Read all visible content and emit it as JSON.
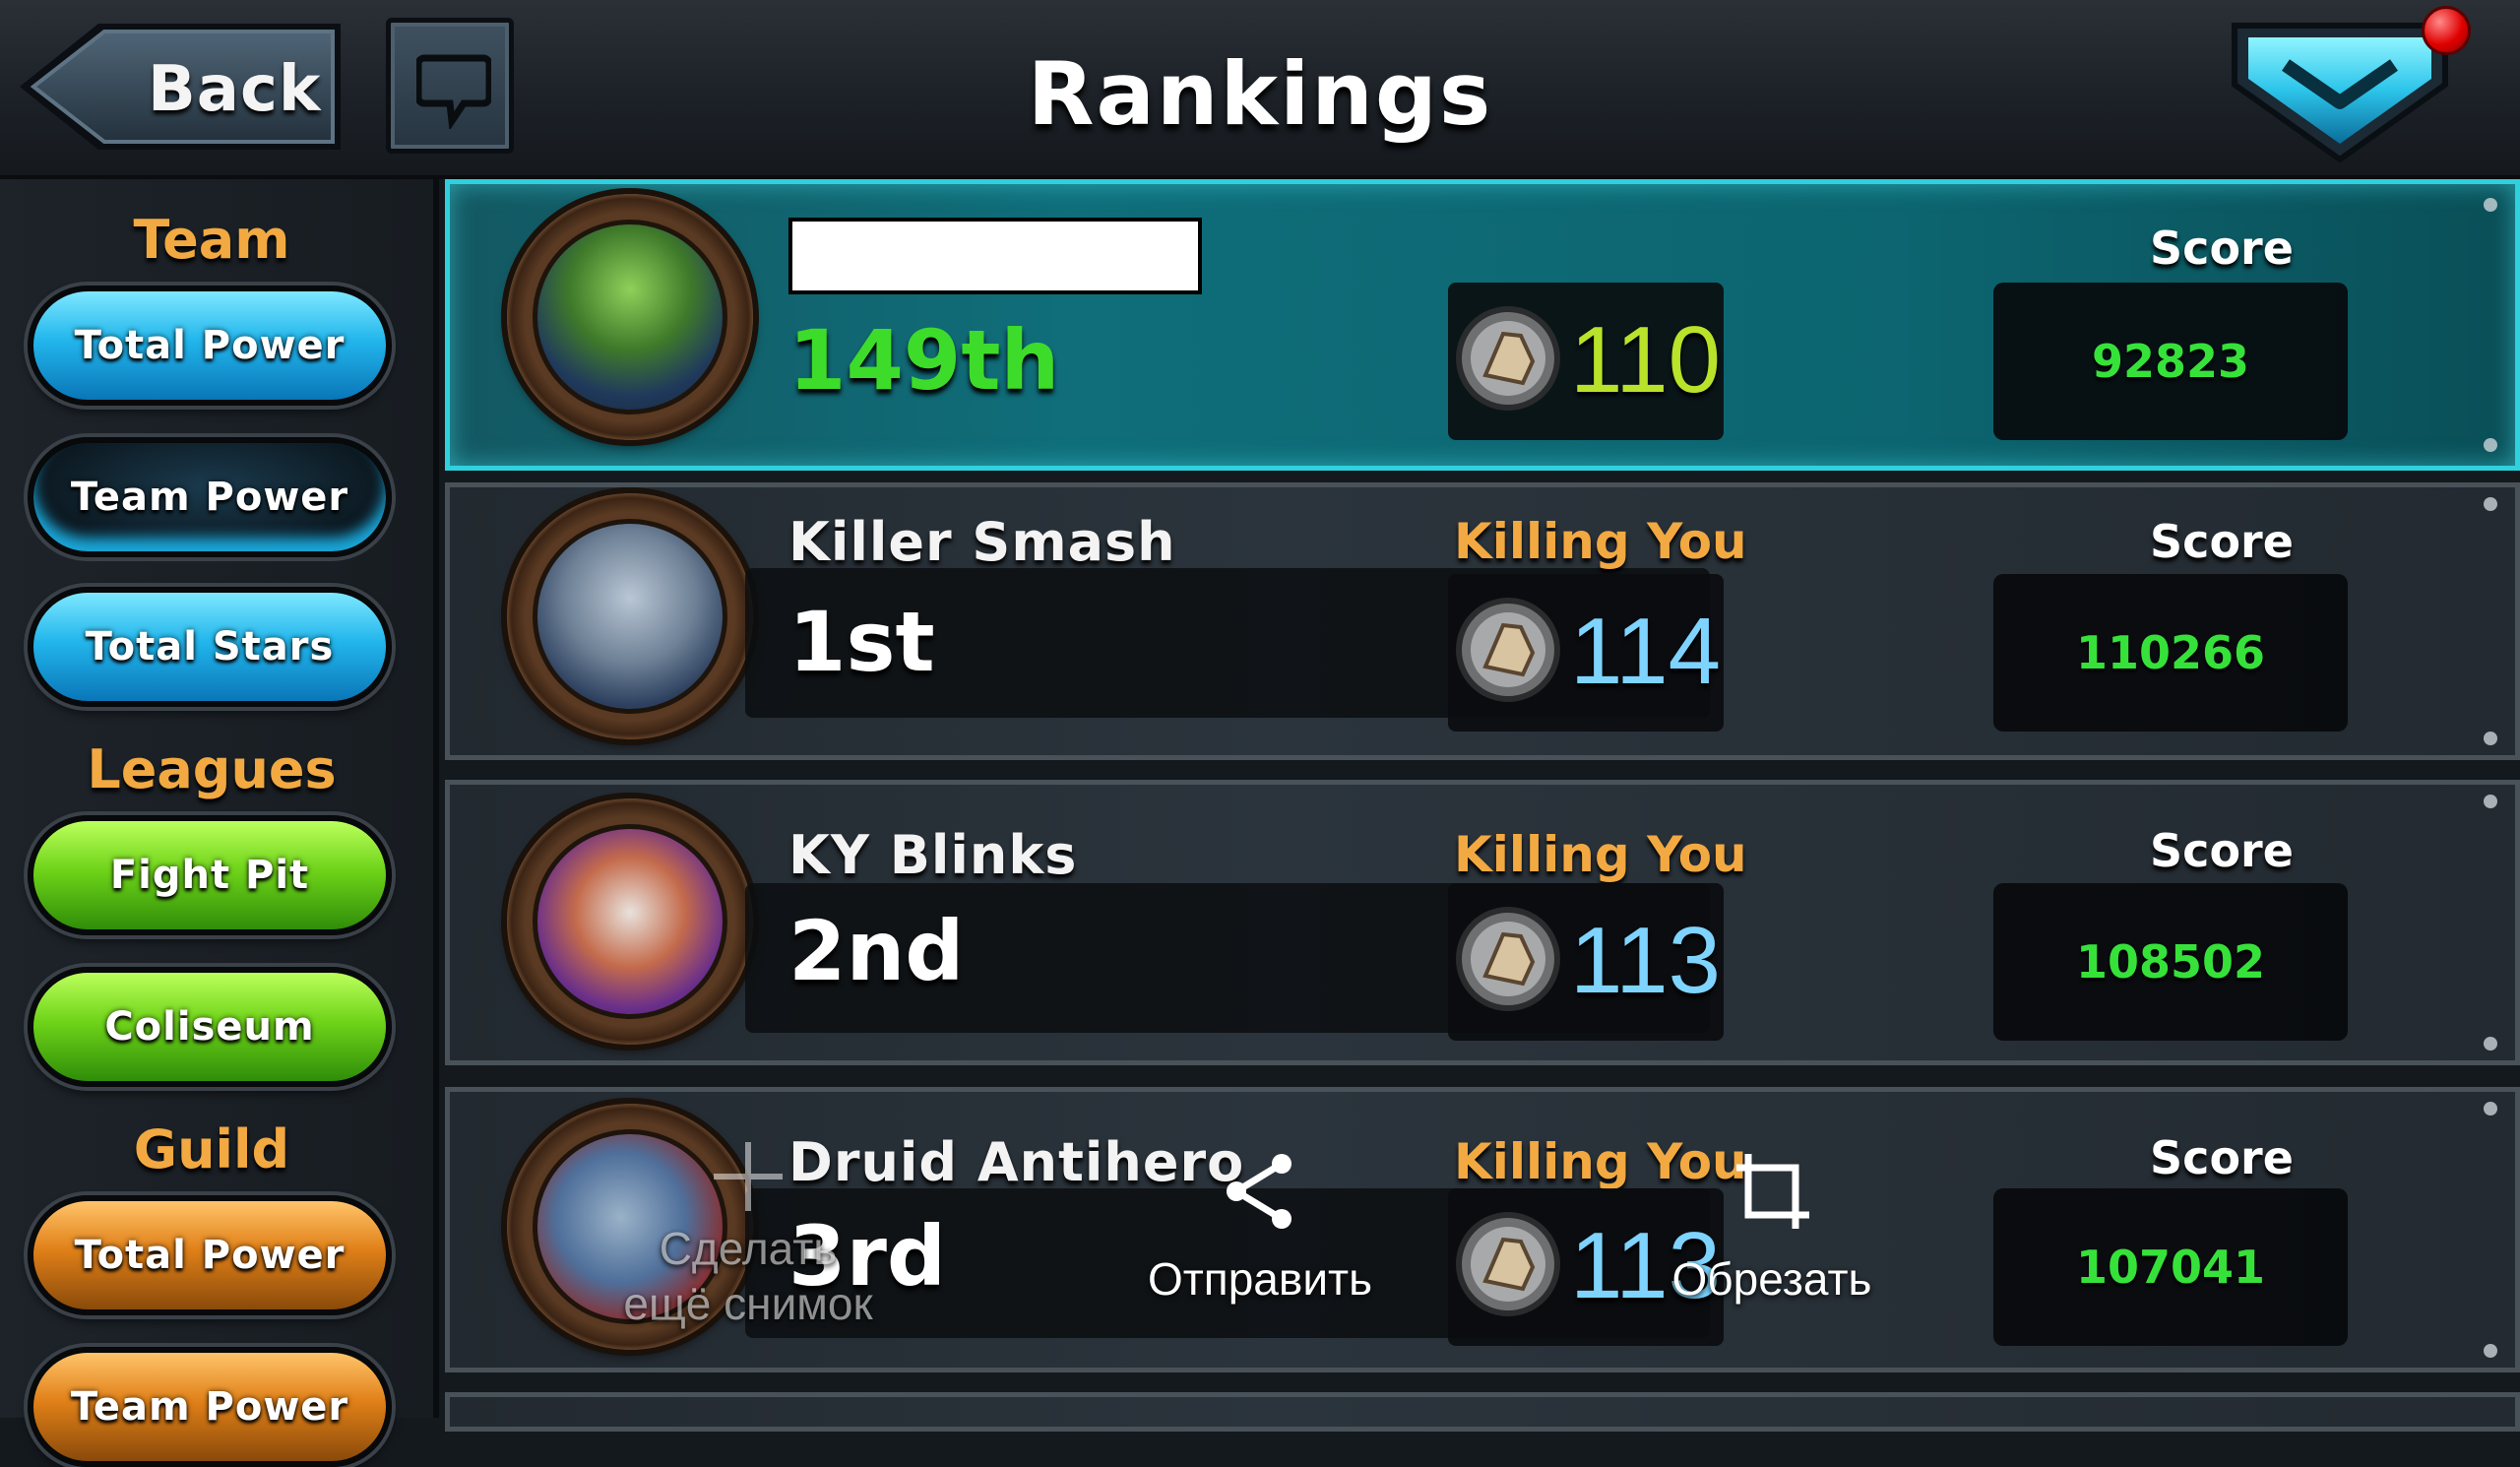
{
  "header": {
    "back_label": "Back",
    "title": "Rankings"
  },
  "sidebar": {
    "team_heading": "Team",
    "team_buttons": [
      "Total Power",
      "Team Power",
      "Total Stars"
    ],
    "leagues_heading": "Leagues",
    "league_buttons": [
      "Fight Pit",
      "Coliseum"
    ],
    "guild_heading": "Guild",
    "guild_buttons": [
      "Total Power",
      "Team Power"
    ]
  },
  "rows": [
    {
      "rank": "149th",
      "name": "",
      "guild": "",
      "power": "110",
      "score_label": "Score",
      "score": "92823",
      "is_me": true
    },
    {
      "rank": "1st",
      "name": "Killer Smash",
      "guild": "Killing You",
      "power": "114",
      "score_label": "Score",
      "score": "110266"
    },
    {
      "rank": "2nd",
      "name": "KY Blinks",
      "guild": "Killing You",
      "power": "113",
      "score_label": "Score",
      "score": "108502"
    },
    {
      "rank": "3rd",
      "name": "Druid Antihero",
      "guild": "Killing You",
      "power": "113",
      "score_label": "Score",
      "score": "107041"
    }
  ],
  "overlay": {
    "another_shot": "Сделать\nещё снимок",
    "share": "Отправить",
    "crop": "Обрезать"
  },
  "colors": {
    "accent_teal": "#2fd1de",
    "heading_orange": "#f2a941",
    "score_green": "#36e23a",
    "power_blue": "#7ed4ff",
    "notification_red": "#e00000"
  },
  "icons": [
    "back-arrow-icon",
    "chat-icon",
    "dropdown-chevron-icon",
    "fist-icon",
    "share-icon",
    "crop-icon",
    "plus-icon"
  ]
}
